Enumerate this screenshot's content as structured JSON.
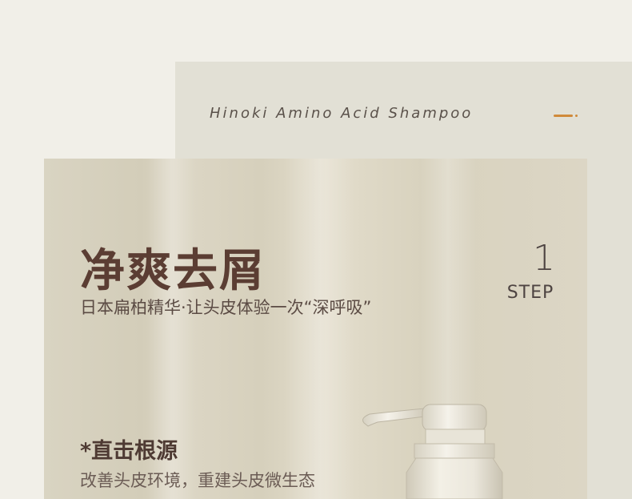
{
  "header": {
    "product_name": "Hinoki Amino Acid Shampoo"
  },
  "hero": {
    "headline": "净爽去屑",
    "subline": "日本扁柏精华·让头皮体验一次“深呼吸”",
    "step_number": "1",
    "step_label": "STEP"
  },
  "feature": {
    "title": "*直击根源",
    "description": "改善头皮环境，重建头皮微生态"
  },
  "colors": {
    "page_bg": "#f1efe8",
    "panel_back": "#e2e0d5",
    "panel_front": "#d9d4c2",
    "accent": "#d08a3a",
    "headline": "#5b3d33"
  }
}
